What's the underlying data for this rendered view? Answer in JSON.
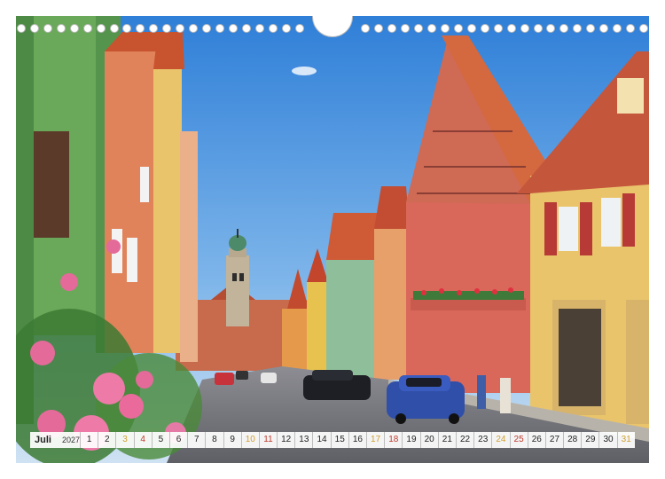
{
  "calendar": {
    "month": "Juli",
    "year": "2027",
    "days": [
      {
        "n": "1",
        "t": ""
      },
      {
        "n": "2",
        "t": ""
      },
      {
        "n": "3",
        "t": "sat"
      },
      {
        "n": "4",
        "t": "sun"
      },
      {
        "n": "5",
        "t": ""
      },
      {
        "n": "6",
        "t": ""
      },
      {
        "n": "7",
        "t": ""
      },
      {
        "n": "8",
        "t": ""
      },
      {
        "n": "9",
        "t": ""
      },
      {
        "n": "10",
        "t": "sat"
      },
      {
        "n": "11",
        "t": "sun"
      },
      {
        "n": "12",
        "t": ""
      },
      {
        "n": "13",
        "t": ""
      },
      {
        "n": "14",
        "t": ""
      },
      {
        "n": "15",
        "t": ""
      },
      {
        "n": "16",
        "t": ""
      },
      {
        "n": "17",
        "t": "sat"
      },
      {
        "n": "18",
        "t": "sun"
      },
      {
        "n": "19",
        "t": ""
      },
      {
        "n": "20",
        "t": ""
      },
      {
        "n": "21",
        "t": ""
      },
      {
        "n": "22",
        "t": ""
      },
      {
        "n": "23",
        "t": ""
      },
      {
        "n": "24",
        "t": "sat"
      },
      {
        "n": "25",
        "t": "sun"
      },
      {
        "n": "26",
        "t": ""
      },
      {
        "n": "27",
        "t": ""
      },
      {
        "n": "28",
        "t": ""
      },
      {
        "n": "29",
        "t": ""
      },
      {
        "n": "30",
        "t": ""
      },
      {
        "n": "31",
        "t": "sat"
      }
    ]
  },
  "colors": {
    "saturday": "#d0a030",
    "sunday": "#c0392b"
  },
  "hole_count": 48
}
